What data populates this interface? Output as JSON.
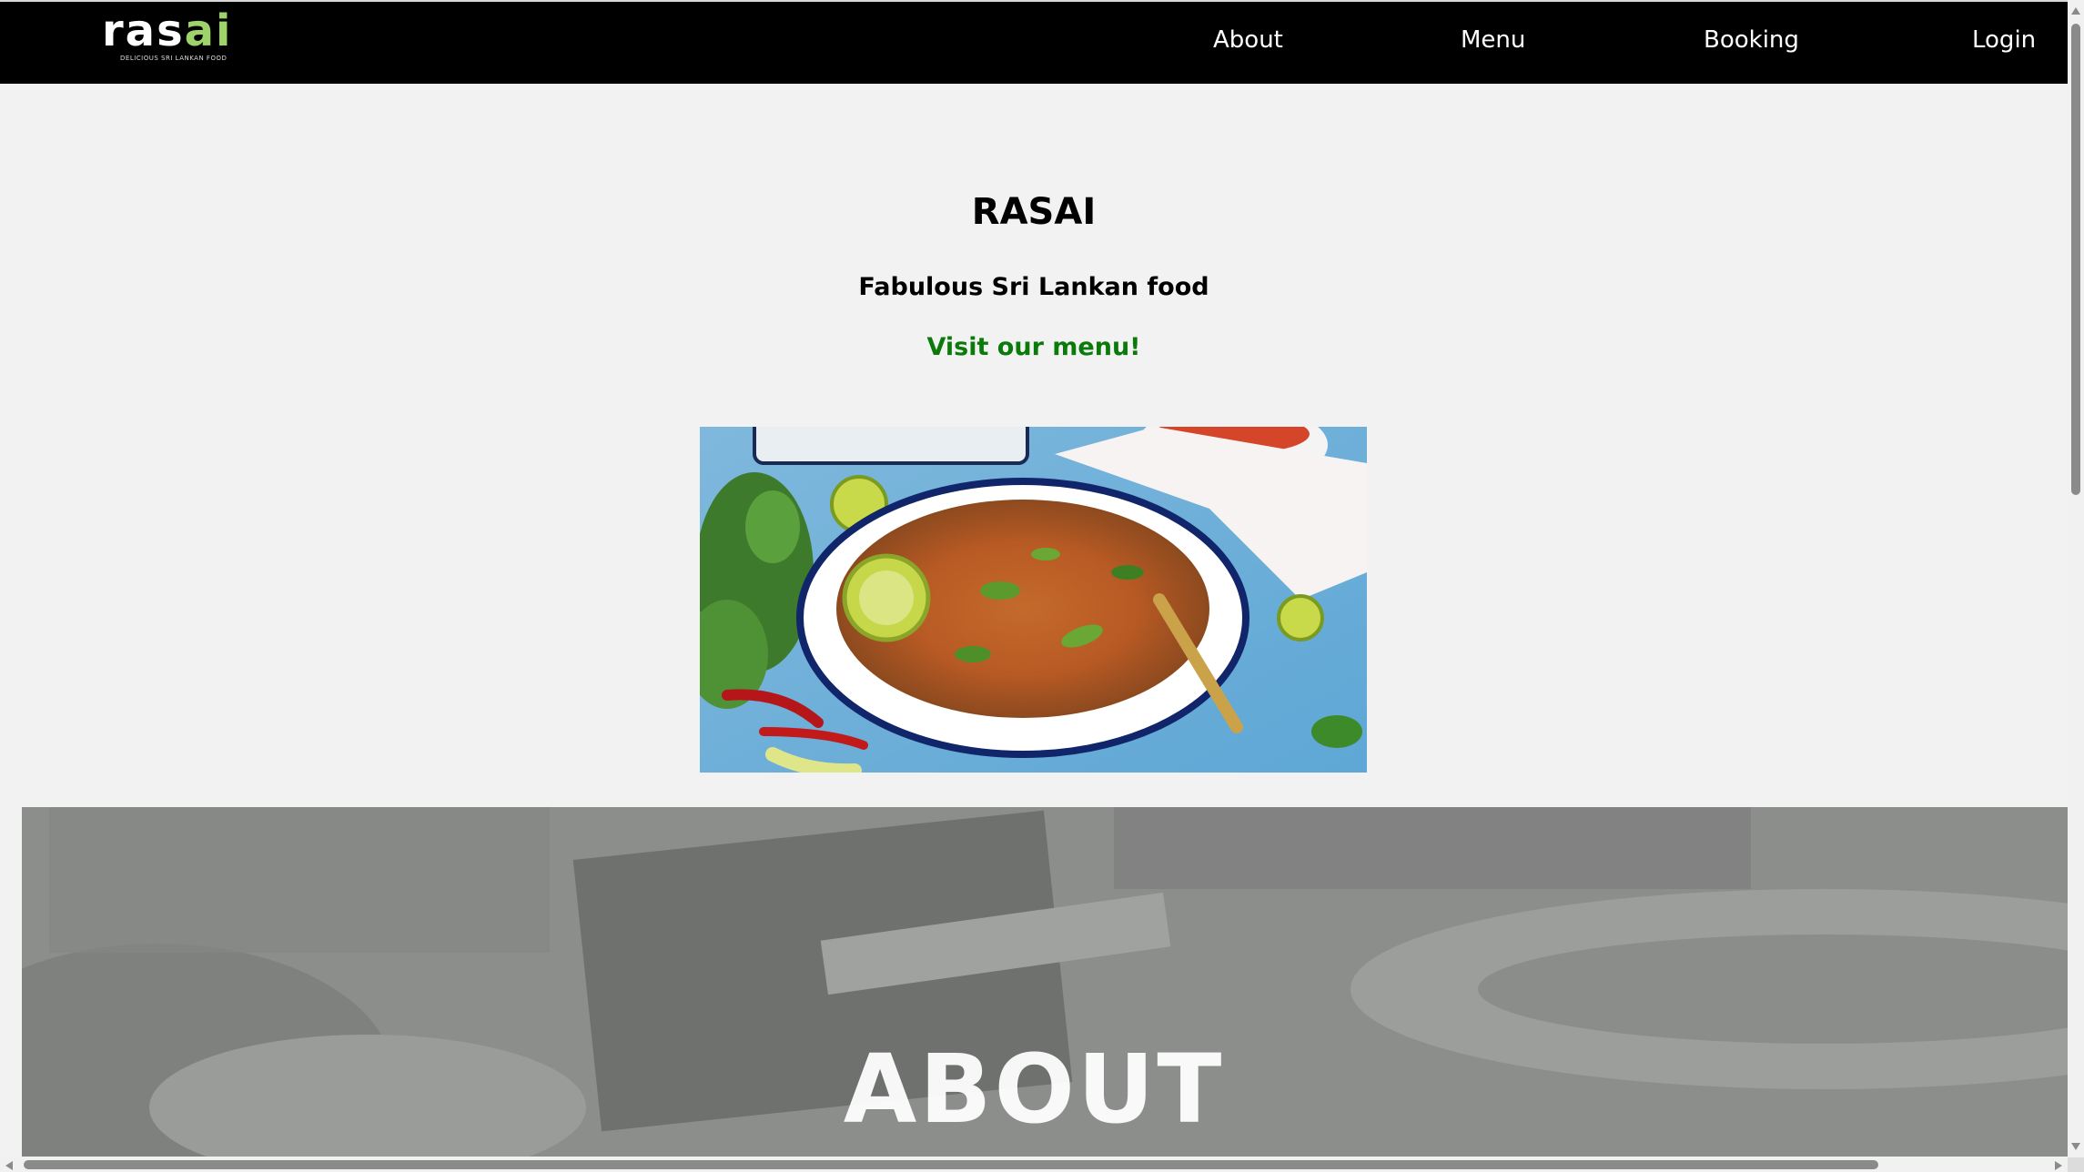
{
  "brand": {
    "logo_text_main": "ras",
    "logo_text_accent": "ai",
    "logo_tagline": "DELICIOUS SRI LANKAN FOOD",
    "accent_color": "#9ed36a"
  },
  "nav": {
    "items": [
      {
        "label": "About"
      },
      {
        "label": "Menu"
      },
      {
        "label": "Booking"
      },
      {
        "label": "Login"
      }
    ]
  },
  "hero": {
    "title": "RASAI",
    "subtitle": "Fabulous Sri Lankan food",
    "cta": "Visit our menu!",
    "cta_color": "#0a7a0a",
    "image_alt": "Sri Lankan kottu dish in a bowl with limes and chillies"
  },
  "about": {
    "heading": "ABOUT"
  }
}
